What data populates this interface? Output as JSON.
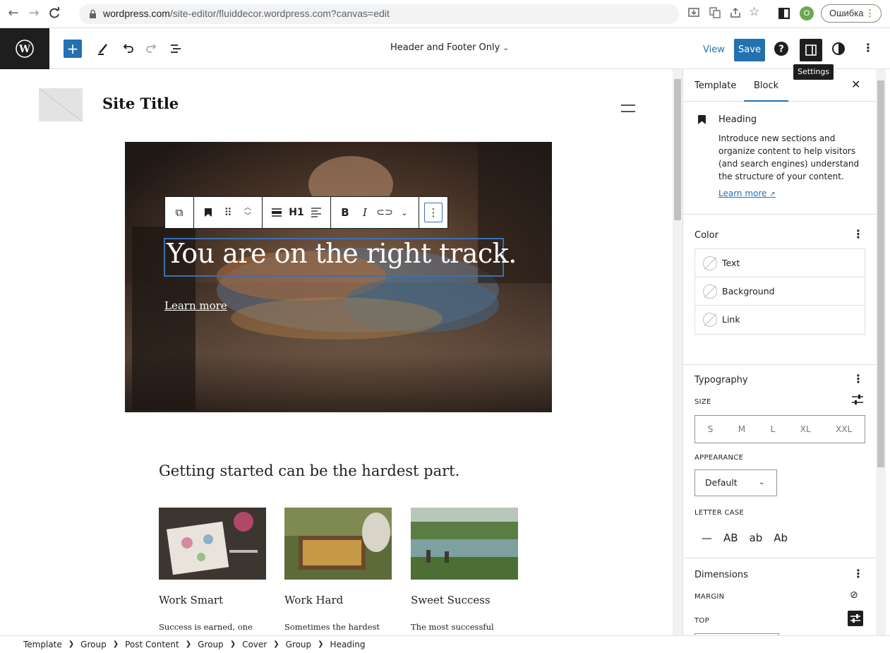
{
  "browser": {
    "url_host": "wordpress.com",
    "url_path": "/site-editor/fluiddecor.wordpress.com?canvas=edit",
    "profile_initial": "O",
    "error_label": "Ошибка"
  },
  "toolbar": {
    "template_name": "Header and Footer Only",
    "view_label": "View",
    "save_label": "Save",
    "settings_tooltip": "Settings"
  },
  "canvas": {
    "site_title": "Site Title",
    "cover_heading": "You are on the right track.",
    "cover_link": "Learn more",
    "heading_level": "H1",
    "section_heading": "Getting started can be the hardest part.",
    "cards": [
      {
        "title": "Work Smart",
        "desc": "Success is earned, one"
      },
      {
        "title": "Work Hard",
        "desc": "Sometimes the hardest"
      },
      {
        "title": "Sweet Success",
        "desc": "The most successful"
      }
    ]
  },
  "sidebar": {
    "tabs": [
      "Template",
      "Block"
    ],
    "active_tab": "Block",
    "block_name": "Heading",
    "block_desc": "Introduce new sections and organize content to help visitors (and search engines) understand the structure of your content.",
    "learn_more": "Learn more",
    "color": {
      "title": "Color",
      "items": [
        "Text",
        "Background",
        "Link"
      ]
    },
    "typography": {
      "title": "Typography",
      "size_label": "SIZE",
      "sizes": [
        "S",
        "M",
        "L",
        "XL",
        "XXL"
      ],
      "appearance_label": "APPEARANCE",
      "appearance_value": "Default",
      "letter_case_label": "LETTER CASE",
      "letter_cases": [
        "—",
        "AB",
        "ab",
        "Ab"
      ]
    },
    "dimensions": {
      "title": "Dimensions",
      "margin_label": "MARGIN",
      "top_label": "TOP"
    }
  },
  "breadcrumb": [
    "Template",
    "Group",
    "Post Content",
    "Group",
    "Cover",
    "Group",
    "Heading"
  ],
  "colors": {
    "accent": "#2271b1",
    "dark": "#1e1e1e",
    "selection": "#3c6fb4"
  }
}
